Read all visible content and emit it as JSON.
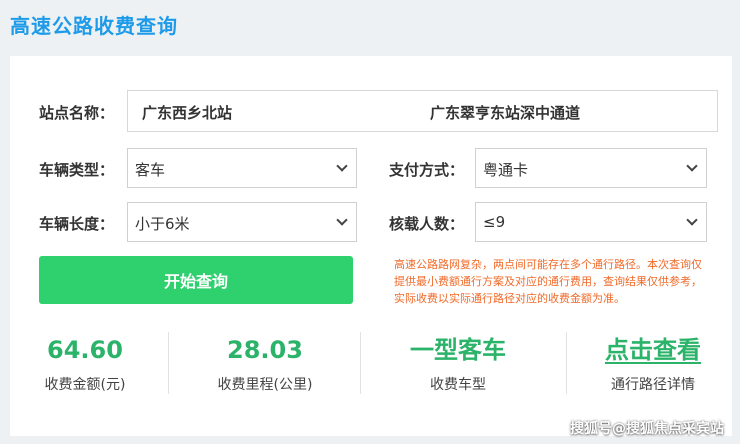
{
  "title": "高速公路收费查询",
  "station": {
    "label": "站点名称：",
    "from": "广东西乡北站",
    "to": "广东翠亨东站深中通道"
  },
  "vehicle_type": {
    "label": "车辆类型：",
    "value": "客车"
  },
  "payment": {
    "label": "支付方式：",
    "value": "粤通卡"
  },
  "vehicle_length": {
    "label": "车辆长度：",
    "value": "小于6米"
  },
  "passengers": {
    "label": "核载人数：",
    "value": "≤9"
  },
  "query_button": "开始查询",
  "notice": "高速公路路网复杂，两点间可能存在多个通行路径。本次查询仅提供最小费额通行方案及对应的通行费用，查询结果仅供参考，实际收费以实际通行路径对应的收费金额为准。",
  "results": [
    {
      "value": "64.60",
      "caption": "收费金额(元)"
    },
    {
      "value": "28.03",
      "caption": "收费里程(公里)"
    },
    {
      "value": "一型客车",
      "caption": "收费车型"
    },
    {
      "value": "点击查看",
      "caption": "通行路径详情"
    }
  ],
  "watermark": "搜狐号@搜狐焦点采宾站",
  "colors": {
    "title": "#1e9be8",
    "button": "#2fd06e",
    "result_value": "#2bb36a",
    "notice": "#f06a28"
  }
}
